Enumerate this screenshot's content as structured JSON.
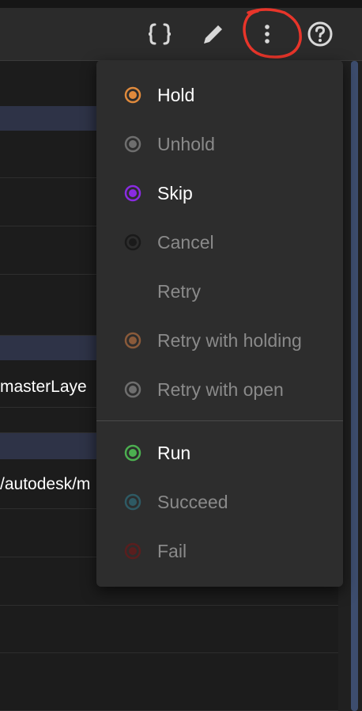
{
  "toolbar": {
    "icons": [
      "braces-icon",
      "pencil-icon",
      "more-vertical-icon",
      "help-icon"
    ]
  },
  "background_rows": {
    "row_master_layer": "masterLaye",
    "row_autodesk_path": "/autodesk/m"
  },
  "menu": {
    "items": [
      {
        "label": "Hold",
        "color": "#e08a3c",
        "enabled": true
      },
      {
        "label": "Unhold",
        "color": "#6e6e6e",
        "enabled": false
      },
      {
        "label": "Skip",
        "color": "#8a2be2",
        "enabled": true
      },
      {
        "label": "Cancel",
        "color": "#1a1a1a",
        "enabled": false
      },
      {
        "label": "Retry",
        "color": "",
        "enabled": false
      },
      {
        "label": "Retry with holding",
        "color": "#8a5a3a",
        "enabled": false
      },
      {
        "label": "Retry with open",
        "color": "#6e6e6e",
        "enabled": false
      },
      {
        "label": "Run",
        "color": "#4caf50",
        "enabled": true
      },
      {
        "label": "Succeed",
        "color": "#2e5a64",
        "enabled": false
      },
      {
        "label": "Fail",
        "color": "#5a1e1e",
        "enabled": false
      }
    ]
  },
  "colors": {
    "annotation_circle": "#e8352a",
    "enabled_text": "#ffffff",
    "disabled_text": "#8a8a8a"
  }
}
